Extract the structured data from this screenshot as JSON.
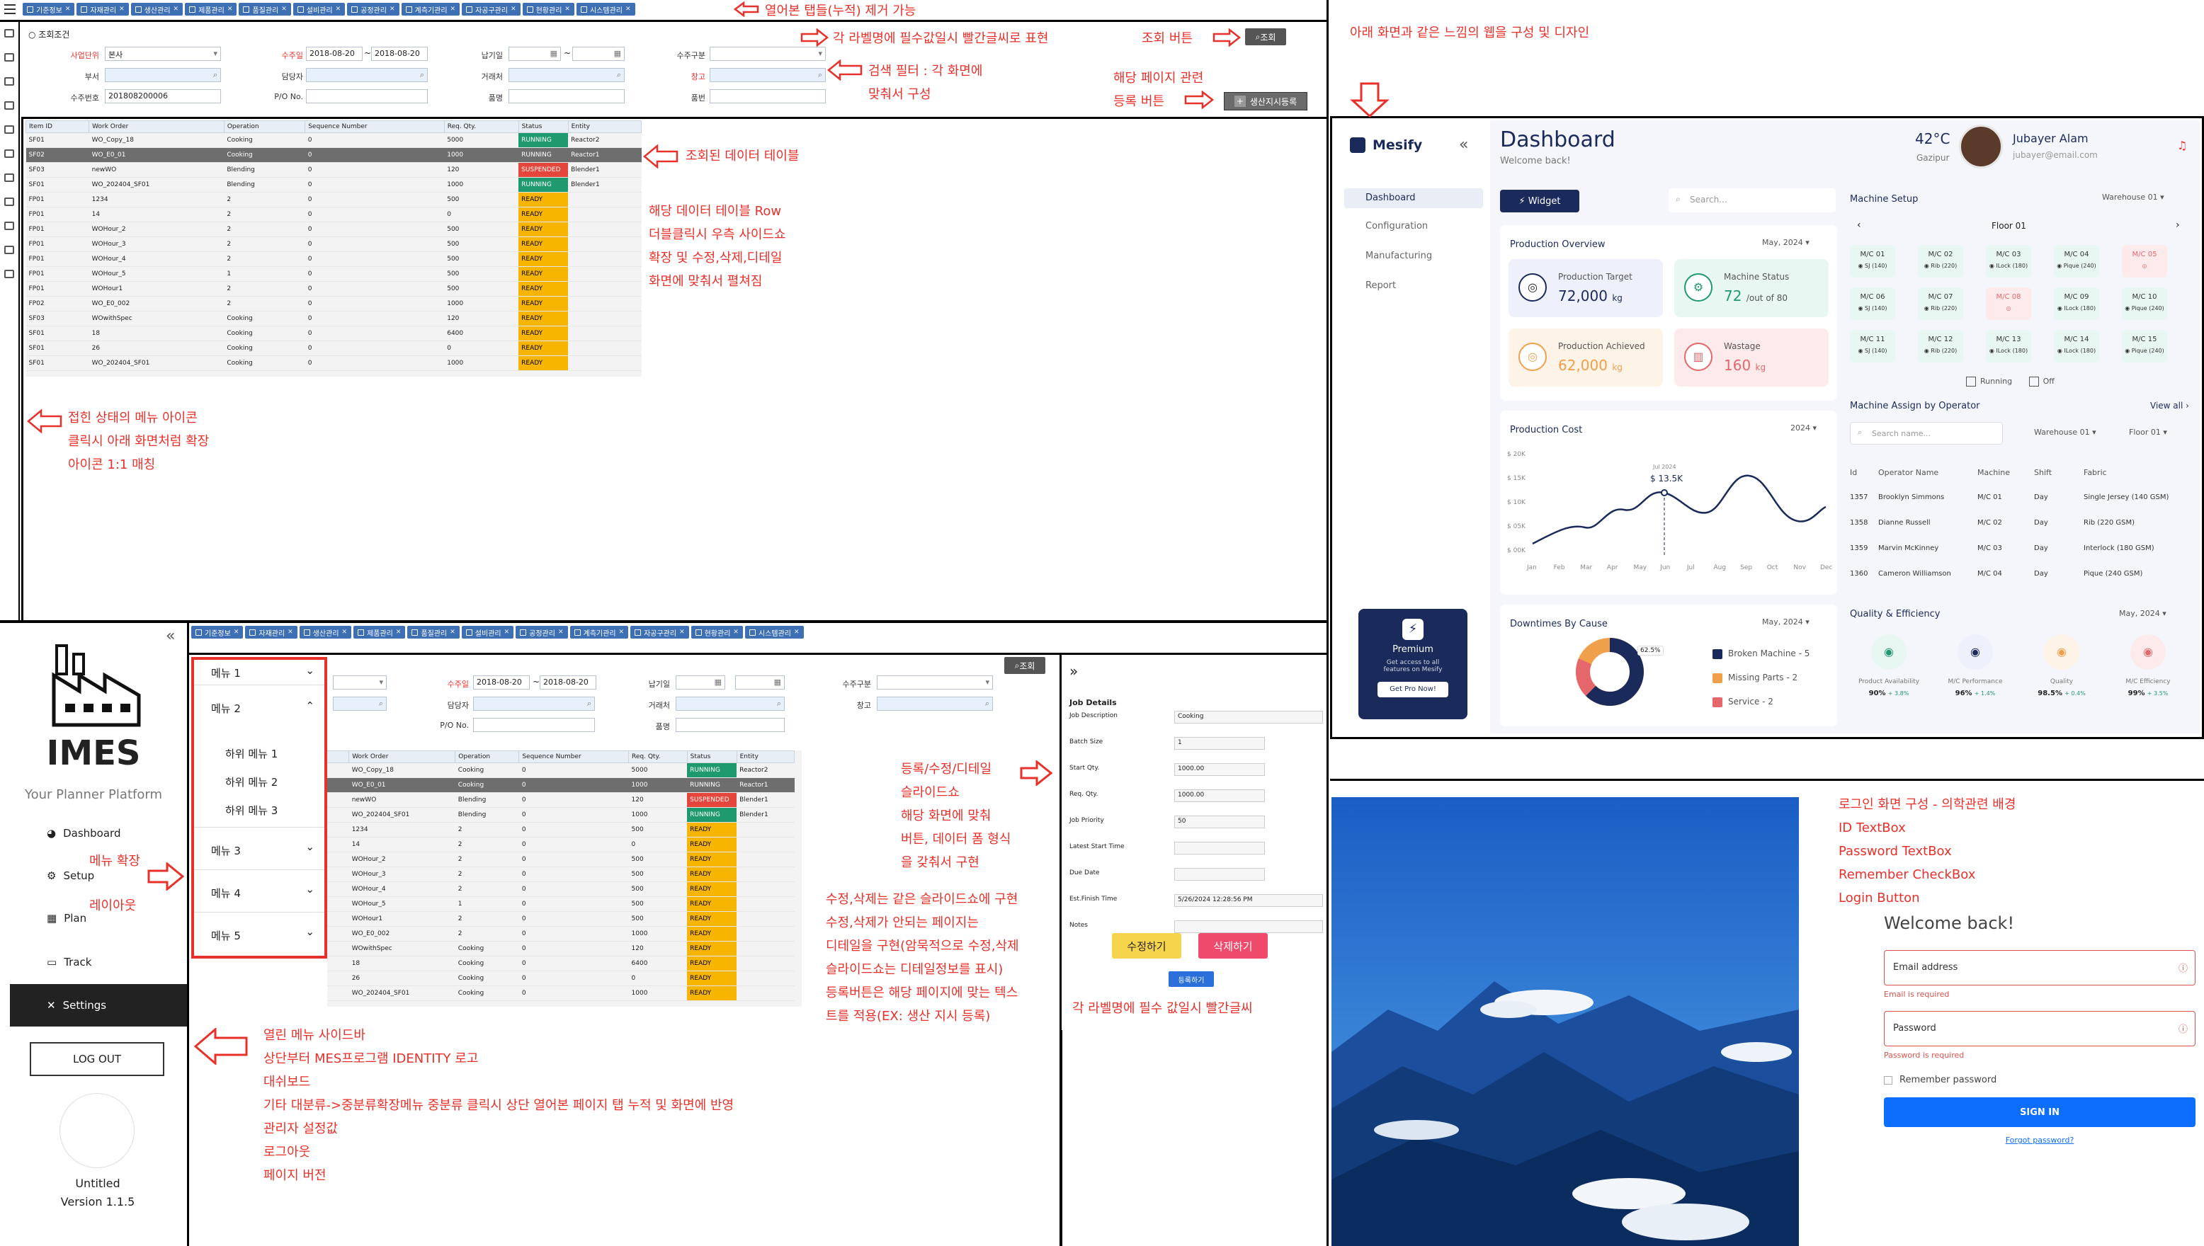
{
  "top_left": {
    "tabs": [
      "기준정보",
      "자재관리",
      "생산관리",
      "제품관리",
      "품질관리",
      "설비관리",
      "공정관리",
      "계측기관리",
      "자공구관리",
      "현황관리",
      "시스템관리"
    ],
    "annotations": {
      "tabs_note": "열어본 탭들(누적) 제거 가능",
      "required_note": "각 라벨명에 필수값일시 빨간글씨로 표현",
      "search_btn_note": "조회 버튼",
      "filter_note_1": "검색 필터 : 각 화면에",
      "filter_note_2": "맞춰서 구성",
      "register_note_1": "해당 페이지 관련",
      "register_note_2": "등록 버튼",
      "table_note": "조회된 데이터 테이블",
      "row_note_1": "해당 데이터 테이블 Row",
      "row_note_2": "더블클릭시 우측 사이드쇼",
      "row_note_3": "확장 및 수정,삭제,디테일",
      "row_note_4": "화면에 맞춰서 펼쳐짐",
      "menu_note_1": "접힌 상태의 메뉴 아이콘",
      "menu_note_2": "클릭시 아래 화면처럼 확장",
      "menu_note_3": "아이콘 1:1 매칭"
    },
    "filter": {
      "title": "조회조건",
      "search_button": "조회",
      "register_button": "생산지시등록",
      "fields": {
        "business_unit_label": "사업단위",
        "business_unit_value": "본사",
        "order_date_label": "수주일",
        "order_date_from": "2018-08-20",
        "order_date_to": "2018-08-20",
        "due_date_label": "납기일",
        "order_type_label": "수주구분",
        "dept_label": "부서",
        "manager_label": "담당자",
        "client_label": "거래처",
        "warehouse_label": "창고",
        "order_no_label": "수주번호",
        "order_no_value": "201808200006",
        "po_label": "P/O No.",
        "product_label": "품명",
        "part_label": "품번"
      }
    },
    "table": {
      "headers": [
        "Item ID",
        "Work Order",
        "Operation",
        "Sequence Number",
        "Req. Qty.",
        "Status",
        "Entity"
      ],
      "rows": [
        [
          "SF01",
          "WO_Copy_18",
          "Cooking",
          "0",
          "5000",
          "RUNNING",
          "Reactor2"
        ],
        [
          "SF02",
          "WO_E0_01",
          "Cooking",
          "0",
          "1000",
          "RUNNING",
          "Reactor1"
        ],
        [
          "SF03",
          "newWO",
          "Blending",
          "0",
          "120",
          "SUSPENDED",
          "Blender1"
        ],
        [
          "SF01",
          "WO_202404_SF01",
          "Blending",
          "0",
          "1000",
          "RUNNING",
          "Blender1"
        ],
        [
          "FP01",
          "1234",
          "2",
          "0",
          "500",
          "READY",
          ""
        ],
        [
          "FP01",
          "14",
          "2",
          "0",
          "0",
          "READY",
          ""
        ],
        [
          "FP01",
          "WOHour_2",
          "2",
          "0",
          "500",
          "READY",
          ""
        ],
        [
          "FP01",
          "WOHour_3",
          "2",
          "0",
          "500",
          "READY",
          ""
        ],
        [
          "FP01",
          "WOHour_4",
          "2",
          "0",
          "500",
          "READY",
          ""
        ],
        [
          "FP01",
          "WOHour_5",
          "1",
          "0",
          "500",
          "READY",
          ""
        ],
        [
          "FP01",
          "WOHour1",
          "2",
          "0",
          "500",
          "READY",
          ""
        ],
        [
          "FP02",
          "WO_E0_002",
          "2",
          "0",
          "1000",
          "READY",
          ""
        ],
        [
          "SF03",
          "WOwithSpec",
          "Cooking",
          "0",
          "120",
          "READY",
          ""
        ],
        [
          "SF01",
          "18",
          "Cooking",
          "0",
          "6400",
          "READY",
          ""
        ],
        [
          "SF01",
          "26",
          "Cooking",
          "0",
          "0",
          "READY",
          ""
        ],
        [
          "SF01",
          "WO_202404_SF01",
          "Cooking",
          "0",
          "1000",
          "READY",
          ""
        ]
      ]
    }
  },
  "dashboard": {
    "annotation": "아래 화면과 같은 느낌의 웹을 구성 및 디자인",
    "brand": "Mesify",
    "nav": [
      "Dashboard",
      "Configuration",
      "Manufacturing",
      "Report"
    ],
    "title": "Dashboard",
    "subtitle": "Welcome back!",
    "temp": "42°C",
    "location": "Gazipur",
    "user_name": "Jubayer Alam",
    "user_email": "jubayer@email.com",
    "widget_btn": "Widget",
    "search_placeholder": "Search...",
    "production_overview": "Production Overview",
    "po_month": "May, 2024",
    "target_label": "Production Target",
    "target_value": "72,000",
    "target_unit": "kg",
    "status_label": "Machine Status",
    "status_value": "72",
    "status_of": "/out of 80",
    "achieved_label": "Production Achieved",
    "achieved_value": "62,000",
    "achieved_unit": "kg",
    "wastage_label": "Wastage",
    "wastage_value": "160",
    "wastage_unit": "kg",
    "cost_title": "Production Cost",
    "cost_year": "2024",
    "cost_tooltip_date": "Jul 2024",
    "cost_tooltip_value": "$ 13.5K",
    "cost_y": [
      "$ 20K",
      "$ 15K",
      "$ 10K",
      "$ 05K",
      "$ 00K"
    ],
    "cost_x": [
      "Jan",
      "Feb",
      "Mar",
      "Apr",
      "May",
      "Jun",
      "Jul",
      "Aug",
      "Sep",
      "Oct",
      "Nov",
      "Dec"
    ],
    "downtime_title": "Downtimes By Cause",
    "downtime_month": "May, 2024",
    "downtime_pct": "62.5%",
    "downtime_legend": [
      "Broken Machine - 5",
      "Missing Parts - 2",
      "Service - 2"
    ],
    "premium_title": "Premium",
    "premium_text_1": "Get access to all",
    "premium_text_2": "features on Mesify",
    "premium_btn": "Get Pro Now!",
    "machine_setup": "Machine Setup",
    "warehouse": "Warehouse 01",
    "floor": "Floor 01",
    "machines": [
      [
        "M/C 01",
        "SJ (140)"
      ],
      [
        "M/C 02",
        "Rib (220)"
      ],
      [
        "M/C 03",
        "ILock (180)"
      ],
      [
        "M/C 04",
        "Pique (240)"
      ],
      [
        "M/C 05",
        ""
      ],
      [
        "M/C 06",
        "SJ (140)"
      ],
      [
        "M/C 07",
        "Rib (220)"
      ],
      [
        "M/C 08",
        ""
      ],
      [
        "M/C 09",
        "ILock (180)"
      ],
      [
        "M/C 10",
        "Pique (240)"
      ],
      [
        "M/C 11",
        "SJ (140)"
      ],
      [
        "M/C 12",
        "Rib (220)"
      ],
      [
        "M/C 13",
        "ILock (180)"
      ],
      [
        "M/C 14",
        "ILock (180)"
      ],
      [
        "M/C 15",
        "Pique (240)"
      ]
    ],
    "legend_running": "Running",
    "legend_off": "Off",
    "assign_title": "Machine Assign by Operator",
    "view_all": "View all",
    "assign_search": "Search name...",
    "assign_wh": "Warehouse 01",
    "assign_floor": "Floor 01",
    "assign_headers": [
      "Id",
      "Operator Name",
      "Machine",
      "Shift",
      "Fabric"
    ],
    "assign_rows": [
      [
        "1357",
        "Brooklyn Simmons",
        "M/C 01",
        "Day",
        "Single Jersey (140 GSM)"
      ],
      [
        "1358",
        "Dianne Russell",
        "M/C 02",
        "Day",
        "Rib (220 GSM)"
      ],
      [
        "1359",
        "Marvin McKinney",
        "M/C 03",
        "Day",
        "Interlock (180 GSM)"
      ],
      [
        "1360",
        "Cameron Williamson",
        "M/C 04",
        "Day",
        "Pique (240 GSM)"
      ]
    ],
    "qe_title": "Quality & Efficiency",
    "qe_month": "May, 2024",
    "qe": [
      [
        "Product Availability",
        "90%",
        "+ 3.8%"
      ],
      [
        "M/C Performance",
        "96%",
        "+ 1.4%"
      ],
      [
        "Quality",
        "98.5%",
        "+ 0.4%"
      ],
      [
        "M/C Efficiency",
        "99%",
        "+ 3.5%"
      ]
    ]
  },
  "bottom_left": {
    "brand": "IMES",
    "tagline": "Your Planner Platform",
    "nav": [
      "Dashboard",
      "Setup",
      "Plan",
      "Track",
      "Settings"
    ],
    "logout": "LOG OUT",
    "profile_name": "Untitled",
    "version": "Version 1.1.5",
    "menus": [
      "메뉴 1",
      "메뉴 2",
      "메뉴 3",
      "메뉴 4",
      "메뉴 5"
    ],
    "submenus": [
      "하위 메뉴 1",
      "하위 메뉴 2",
      "하위 메뉴 3"
    ],
    "annotations": {
      "expand_1": "메뉴 확장",
      "expand_2": "레이아웃",
      "sidebar_1": "열린 메뉴 사이드바",
      "sidebar_2": "상단부터 MES프로그램 IDENTITY 로고",
      "sidebar_3": "대쉬보드",
      "sidebar_4": "기타 대분류->중분류확장메뉴 중분류 클릭시 상단 열어본 페이지 탭 누적 및 화면에 반영",
      "sidebar_5": "관리자 설정값",
      "sidebar_6": "로그아웃",
      "sidebar_7": "페이지 버전",
      "slide_1": "등록/수정/디테일",
      "slide_2": "슬라이드쇼",
      "slide_3": "해당 화면에 맞춰",
      "slide_4": "버튼, 데이터 폼 형식",
      "slide_5": "을 갖춰서 구현",
      "edit_1": "수정,삭제는 같은 슬라이드쇼에 구현",
      "edit_2": "수정,삭제가 안되는 페이지는",
      "edit_3": "디테일을 구현(암묵적으로 수정,삭제",
      "edit_4": "슬라이드쇼는 디테일정보를 표시)",
      "edit_5": "등록버튼은 해당 페이지에 맞는 텍스",
      "edit_6": "트를 적용(EX: 생산 지시 등록)",
      "required_note": "각 라벨명에 필수 값일시 빨간글씨"
    },
    "job": {
      "title": "Job Details",
      "fields": [
        [
          "Job Description",
          "Cooking"
        ],
        [
          "Batch Size",
          "1"
        ],
        [
          "Start Qty.",
          "1000.00"
        ],
        [
          "Req. Qty.",
          "1000.00"
        ],
        [
          "Job Priority",
          "50"
        ],
        [
          "Latest Start Time",
          ""
        ],
        [
          "Due Date",
          ""
        ],
        [
          "Est.Finish Time",
          "5/26/2024 12:28:56 PM"
        ],
        [
          "Notes",
          ""
        ]
      ],
      "edit_btn": "수정하기",
      "delete_btn": "삭제하기",
      "register_btn": "등록하기"
    }
  },
  "login": {
    "annotation_1": "로그인 화면 구성 - 의학관련 배경",
    "annotation_2": "ID TextBox",
    "annotation_3": "Password TextBox",
    "annotation_4": "Remember CheckBox",
    "annotation_5": "Login Button",
    "title": "Welcome back!",
    "email_placeholder": "Email address",
    "email_error": "Email is required",
    "password_placeholder": "Password",
    "password_error": "Password is required",
    "remember": "Remember password",
    "sign_in": "SIGN IN",
    "forgot": "Forgot password?"
  }
}
